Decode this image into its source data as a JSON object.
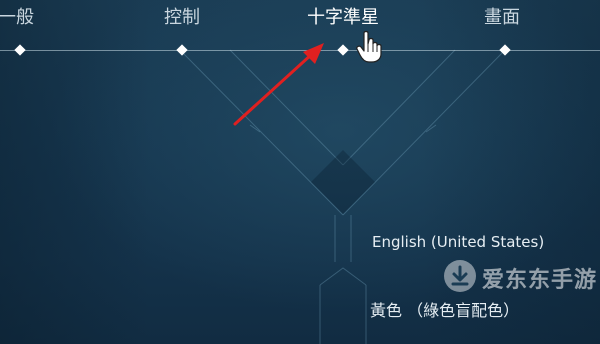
{
  "tabs": {
    "general": "一般",
    "controls": "控制",
    "crosshair": "十字準星",
    "video": "畫面"
  },
  "settings": {
    "language": "English (United States)",
    "crosshair_color": "黃色 （綠色盲配色）"
  },
  "watermark": {
    "text": "爱东东手游"
  },
  "colors": {
    "accent": "#ffffff",
    "annotation_arrow": "#e02020",
    "background": "#143349"
  },
  "icons": {
    "cursor": "hand-pointer-icon",
    "annotation": "red-arrow-icon",
    "watermark_logo": "download-logo-icon"
  }
}
